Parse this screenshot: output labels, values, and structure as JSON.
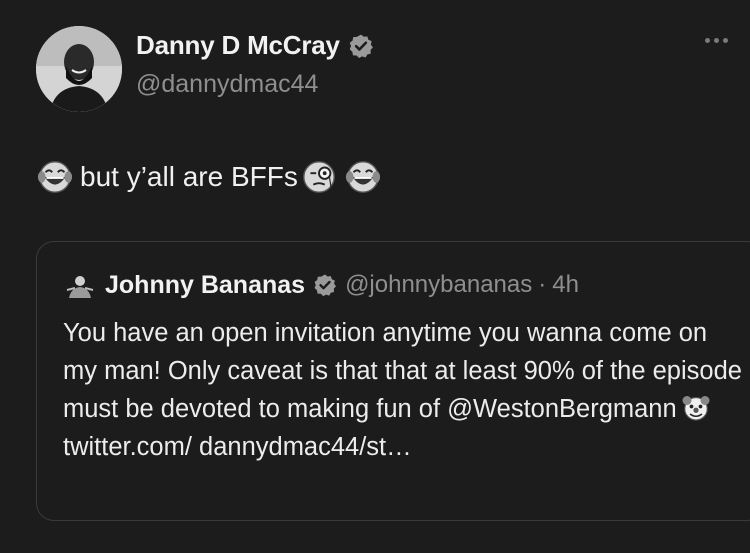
{
  "author": {
    "display_name": "Danny D McCray",
    "handle": "@dannydmac44",
    "verified": true
  },
  "tweet": {
    "text": "but y’all are BFFs",
    "emojis": [
      "joy-emoji",
      "monocle-face-emoji",
      "joy-emoji"
    ]
  },
  "quoted": {
    "display_name": "Johnny Bananas",
    "handle": "@johnnybananas",
    "separator": "·",
    "time": "4h",
    "body_line1": "You have an open invitation anytime you wanna come on my man! Only caveat is that that at least 90% of the episode must be devoted to making fun of @WestonBergmann",
    "body_line2": "twitter.com/ dannydmac44/st…",
    "emoji": "clown-face-emoji"
  },
  "colors": {
    "background": "#1c1c1c",
    "text": "#f0f0f0",
    "muted": "#8f8f8f",
    "border": "#3a3a3a"
  },
  "icons": {
    "verified": "verified-badge-icon",
    "more": "more-options-icon"
  }
}
